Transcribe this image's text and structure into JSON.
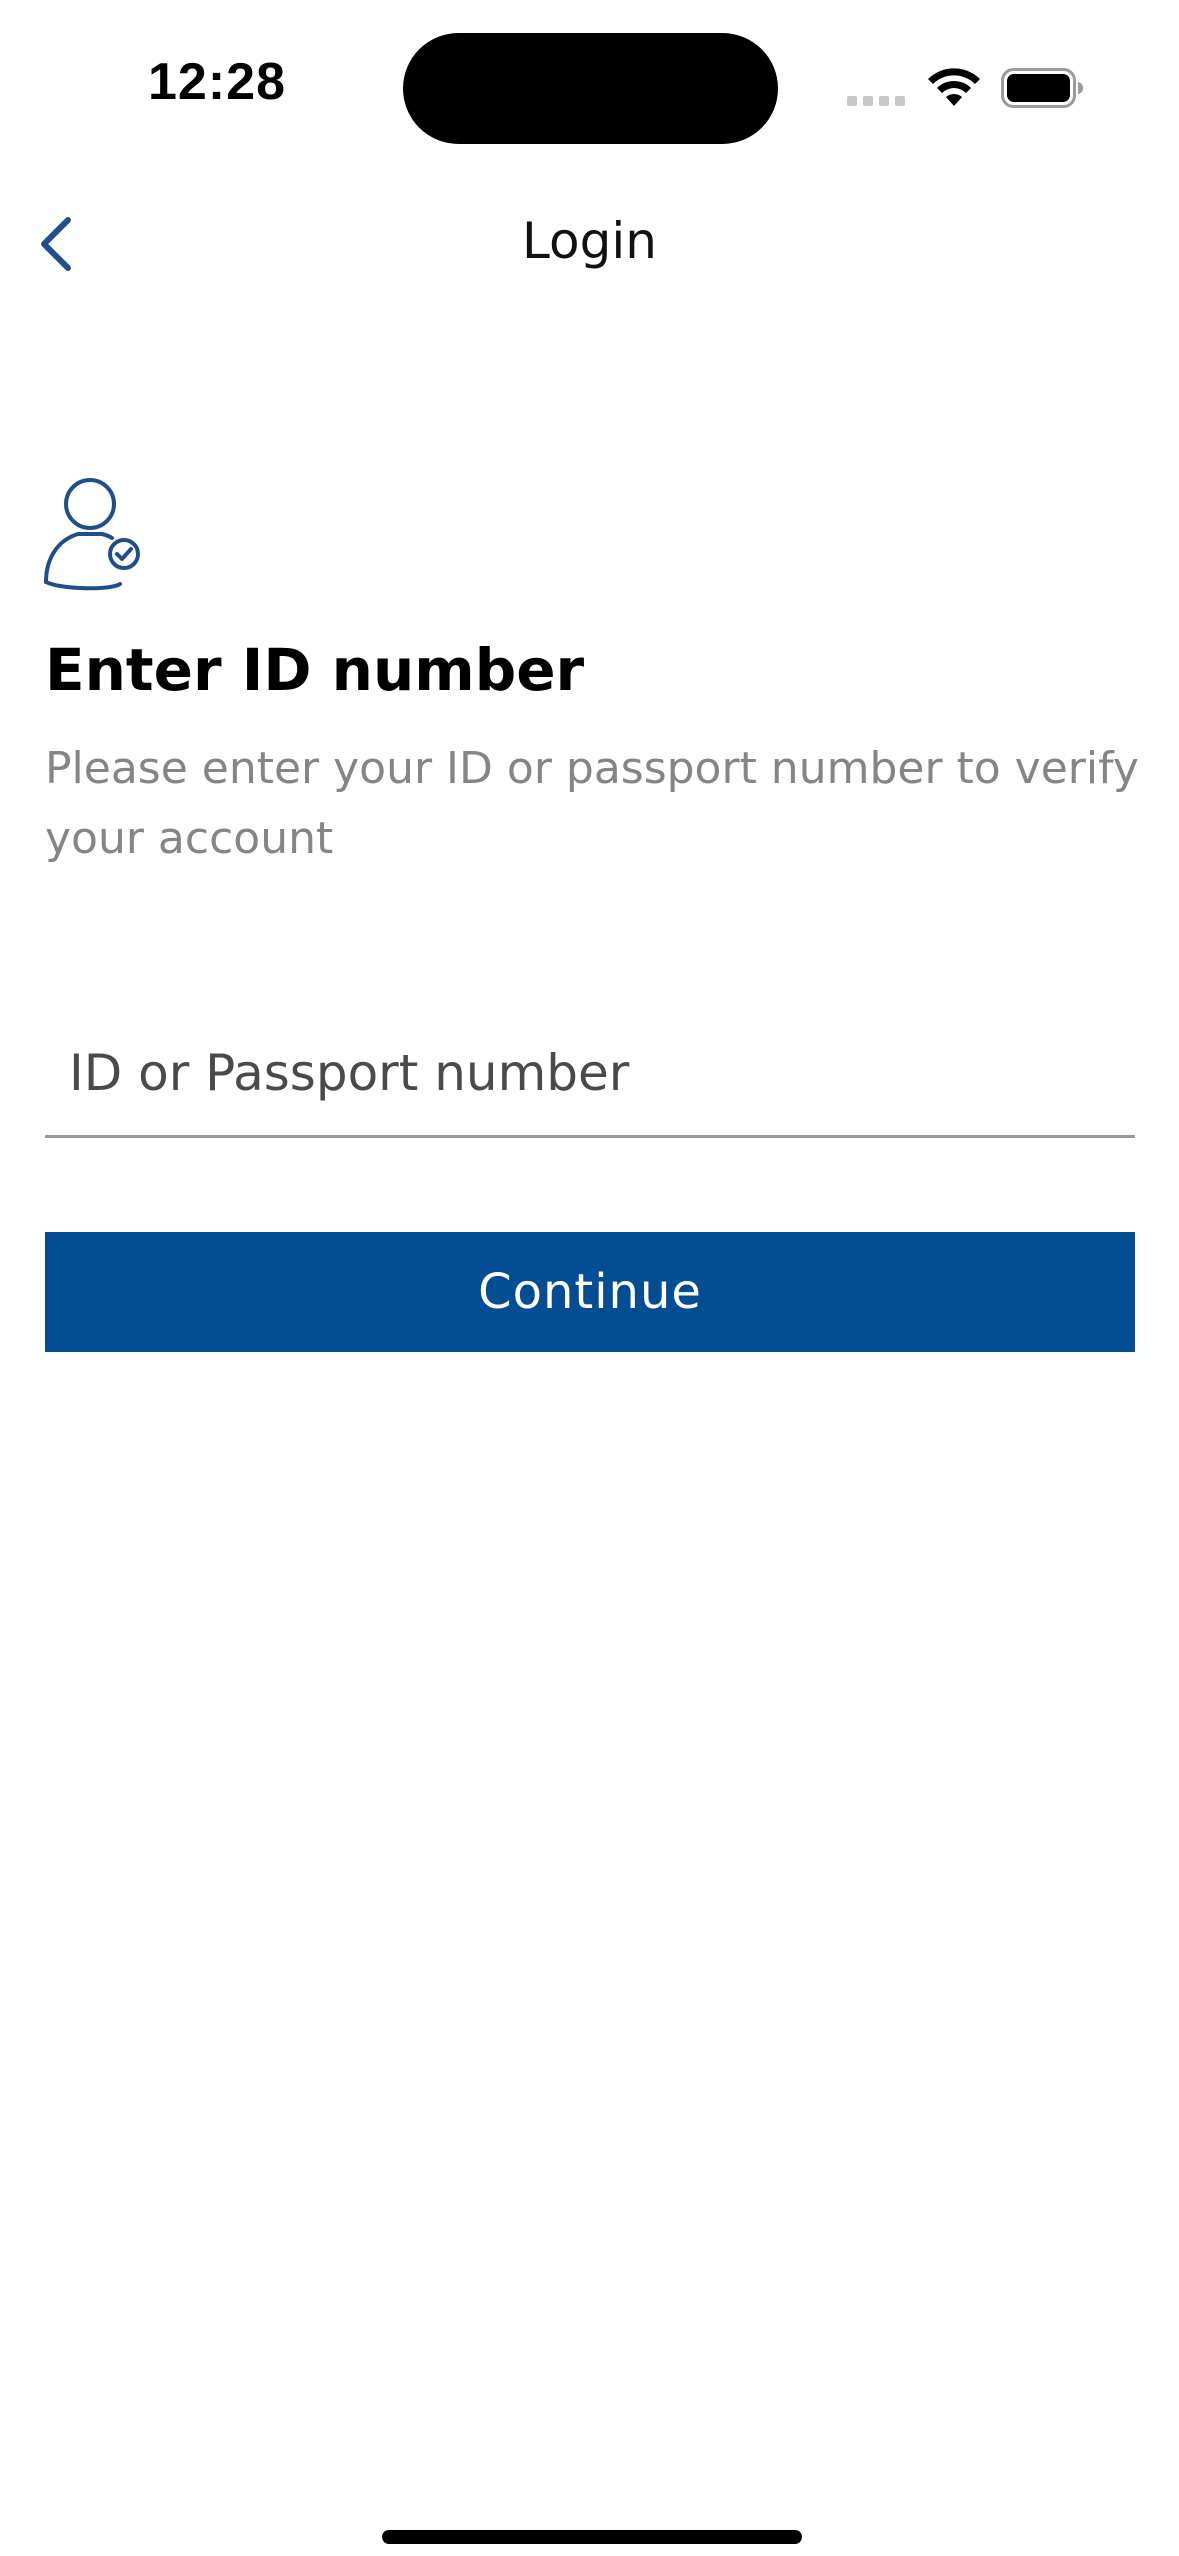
{
  "status_bar": {
    "time": "12:28",
    "icons": [
      "cellular-signal-icon",
      "wifi-icon",
      "battery-icon"
    ]
  },
  "nav": {
    "title": "Login",
    "back_icon": "chevron-left-icon"
  },
  "content": {
    "icon": "user-verify-icon",
    "heading": "Enter ID number",
    "subtext": "Please enter your ID or passport number to verify your account"
  },
  "form": {
    "id_input": {
      "value": "",
      "placeholder": "ID or Passport number"
    },
    "continue_label": "Continue"
  },
  "colors": {
    "accent": "#034d92",
    "icon_blue": "#1f4e8c",
    "subtext_gray": "#858585"
  }
}
